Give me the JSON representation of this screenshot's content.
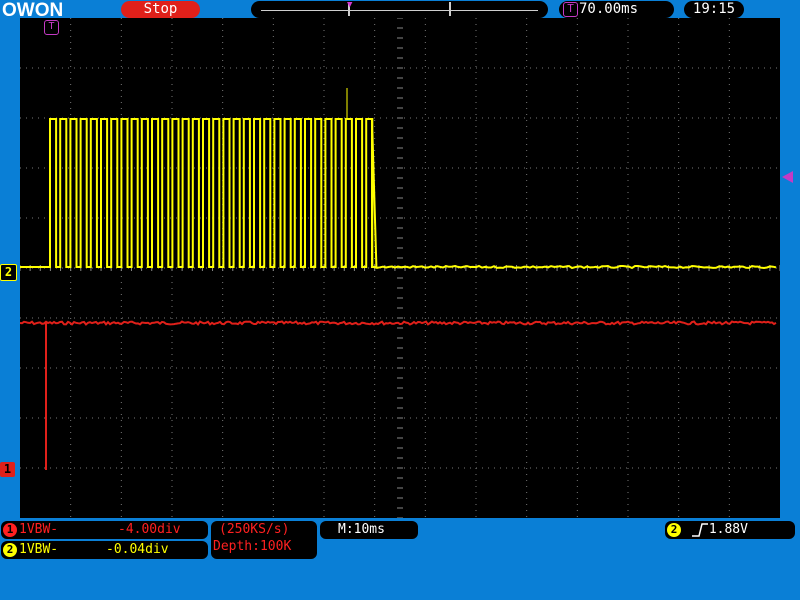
{
  "header": {
    "logo": "OWON",
    "status": "Stop",
    "trigger_offset": "70.00ms",
    "time": "19:15",
    "trigger_icon": "T"
  },
  "channels": {
    "ch1": {
      "badge": "1",
      "label": "1VBW-",
      "offset": "-4.00div",
      "color": "#e0201a"
    },
    "ch2": {
      "badge": "2",
      "label": "1VBW-",
      "offset": "-0.04div",
      "color": "#ffff00"
    }
  },
  "acquisition": {
    "sample_rate": "(250KS/s)",
    "depth": "Depth:100K"
  },
  "timebase": "M:10ms",
  "trigger": {
    "channel": "2",
    "edge_icon": "rising-edge-icon",
    "level": "1.88V"
  },
  "colors": {
    "background": "#0a7fd6",
    "accent_trigger": "#c43ac4"
  }
}
